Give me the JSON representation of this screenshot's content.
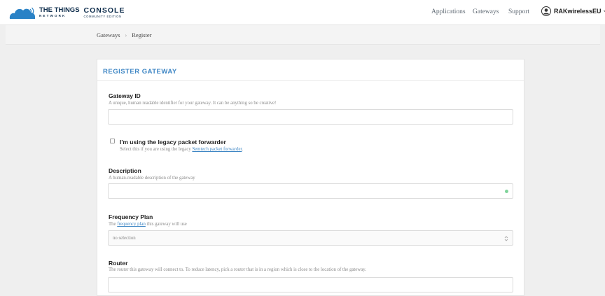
{
  "header": {
    "logo": {
      "line1": "THE THINGS",
      "line2": "NETWORK",
      "product": "CONSOLE",
      "edition": "COMMUNITY EDITION"
    },
    "nav": [
      "Applications",
      "Gateways",
      "Support"
    ],
    "user": {
      "name": "RAKwirelessEU"
    }
  },
  "breadcrumb": {
    "items": [
      "Gateways",
      "Register"
    ],
    "separator": "›"
  },
  "card": {
    "title": "REGISTER GATEWAY"
  },
  "form": {
    "gateway_id": {
      "label": "Gateway ID",
      "help": "A unique, human readable identifier for your gateway. It can be anything so be creative!",
      "value": ""
    },
    "legacy": {
      "label": "I'm using the legacy packet forwarder",
      "help_prefix": "Select this if you are using the legacy ",
      "help_link": "Semtech packet forwarder",
      "help_suffix": ".",
      "checked": false
    },
    "description": {
      "label": "Description",
      "help": "A human-readable description of the gateway",
      "value": ""
    },
    "frequency_plan": {
      "label": "Frequency Plan",
      "help_prefix": "The ",
      "help_link": "frequency plan",
      "help_suffix": " this gateway will use",
      "selected": "no selection"
    },
    "router": {
      "label": "Router",
      "help": "The router this gateway will connect to. To reduce latency, pick a router that is in a region which is close to the location of the gateway.",
      "value": ""
    }
  },
  "colors": {
    "brand_navy": "#0d2c4b",
    "brand_blue": "#2a82c6",
    "accent": "#3e86c4",
    "valid_dot": "#7fd49a",
    "page_background": "#efefef"
  },
  "icons": {
    "logo": "ttn-cloud-icon",
    "user": "user-avatar-icon",
    "user_menu": "chevron-down-icon",
    "select": "select-arrows-icon"
  }
}
